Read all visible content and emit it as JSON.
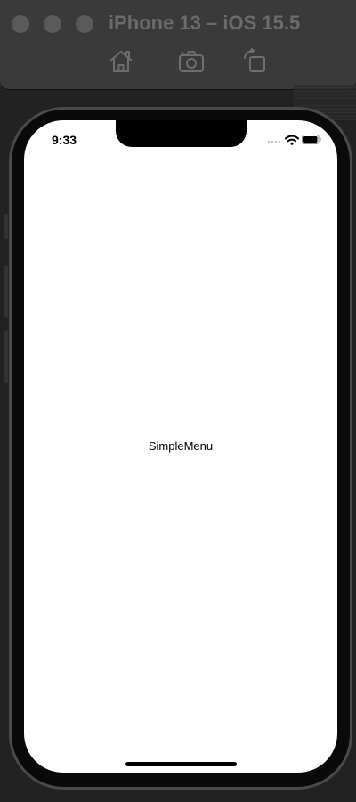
{
  "simulator": {
    "title": "iPhone 13 – iOS 15.5",
    "toolbar": {
      "home": "home-icon",
      "screenshot": "camera-icon",
      "rotate": "rotate-icon"
    }
  },
  "status_bar": {
    "time": "9:33"
  },
  "app": {
    "label": "SimpleMenu"
  },
  "colors": {
    "screen_background": "#ffffff",
    "device_frame": "#0a0a0a",
    "titlebar": "#3a3a3a"
  }
}
